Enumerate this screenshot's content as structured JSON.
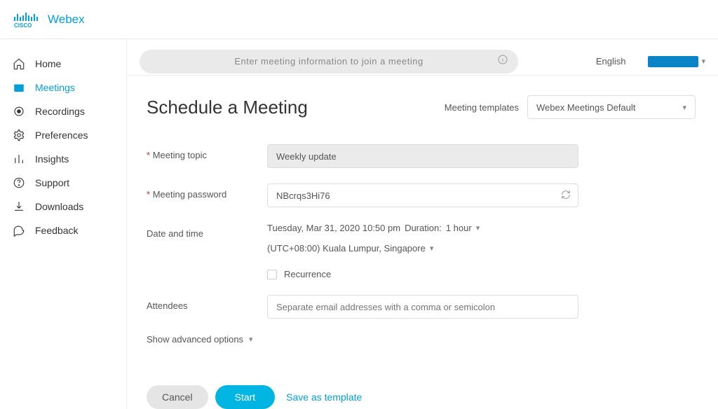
{
  "brand": {
    "product": "Webex"
  },
  "search": {
    "placeholder": "Enter meeting information to join a meeting"
  },
  "header": {
    "language": "English"
  },
  "sidebar": {
    "items": [
      {
        "label": "Home"
      },
      {
        "label": "Meetings"
      },
      {
        "label": "Recordings"
      },
      {
        "label": "Preferences"
      },
      {
        "label": "Insights"
      },
      {
        "label": "Support"
      },
      {
        "label": "Downloads"
      },
      {
        "label": "Feedback"
      }
    ]
  },
  "page": {
    "title": "Schedule a Meeting",
    "templates_label": "Meeting templates",
    "templates_selected": "Webex Meetings Default"
  },
  "form": {
    "topic_label": "Meeting topic",
    "topic_value": "Weekly update",
    "password_label": "Meeting password",
    "password_value": "NBcrqs3Hi76",
    "datetime_label": "Date and time",
    "datetime_value": "Tuesday, Mar 31, 2020 10:50 pm",
    "duration_label": "Duration:",
    "duration_value": "1 hour",
    "timezone": "(UTC+08:00) Kuala Lumpur, Singapore",
    "recurrence_label": "Recurrence",
    "attendees_label": "Attendees",
    "attendees_placeholder": "Separate email addresses with a comma or semicolon",
    "advanced_label": "Show advanced options"
  },
  "actions": {
    "cancel": "Cancel",
    "start": "Start",
    "save_template": "Save as template"
  }
}
